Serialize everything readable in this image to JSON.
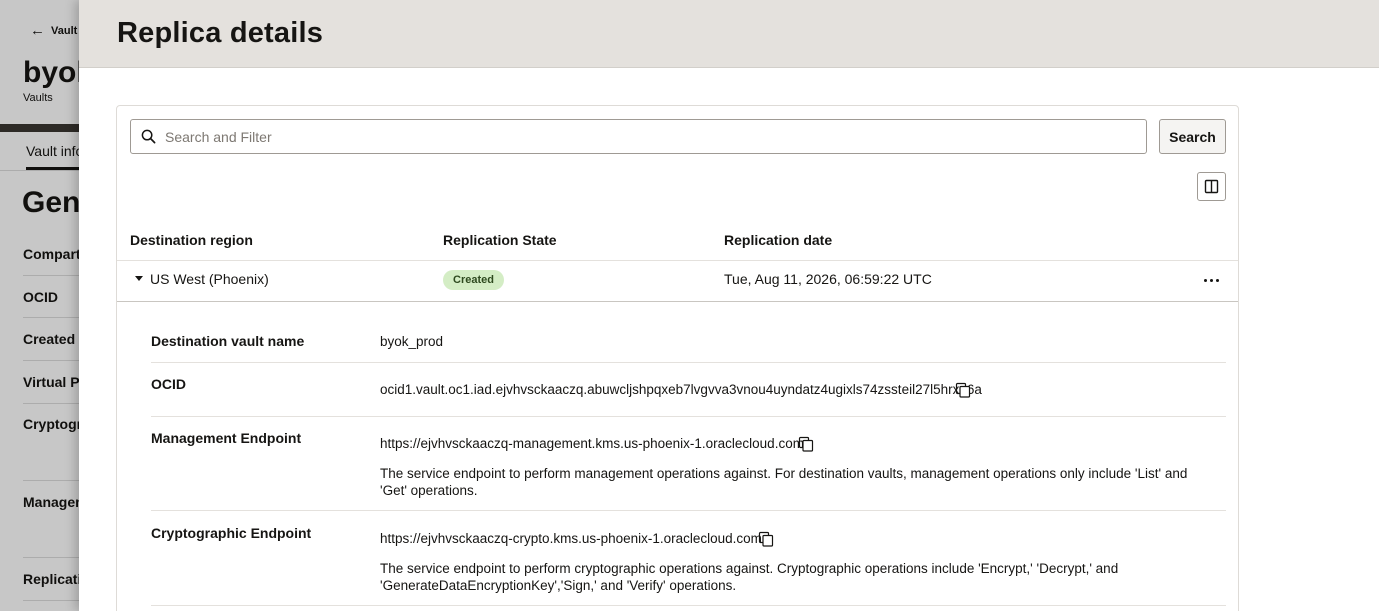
{
  "background_page": {
    "back_link": "Vault",
    "title": "byok",
    "subtitle": "Vaults",
    "tab": "Vault info",
    "section_title": "Gene",
    "labels": [
      "Compartm",
      "OCID",
      "Created",
      "Virtual Pr",
      "Cryptograp",
      "Managem",
      "Replicatio"
    ]
  },
  "panel": {
    "title": "Replica details",
    "search": {
      "placeholder": "Search and Filter",
      "button": "Search"
    },
    "table": {
      "headers": [
        "Destination region",
        "Replication State",
        "Replication date"
      ],
      "row": {
        "region": "US West (Phoenix)",
        "state": "Created",
        "date": "Tue, Aug 11, 2026, 06:59:22 UTC"
      }
    },
    "details": {
      "vault_name_label": "Destination vault name",
      "vault_name": "byok_prod",
      "ocid_label": "OCID",
      "ocid": "ocid1.vault.oc1.iad.ejvhvsckaaczq.abuwcljshpqxeb7lvgvva3vnou4uyndatz4ugixls74zssteil27l5hrxp6a",
      "mgmt_label": "Management Endpoint",
      "mgmt_url": "https://ejvhvsckaaczq-management.kms.us-phoenix-1.oraclecloud.com",
      "mgmt_desc": "The service endpoint to perform management operations against. For destination vaults, management operations only include 'List' and 'Get' operations.",
      "crypto_label": "Cryptographic Endpoint",
      "crypto_url": "https://ejvhvsckaaczq-crypto.kms.us-phoenix-1.oraclecloud.com",
      "crypto_desc": "The service endpoint to perform cryptographic operations against. Cryptographic operations include 'Encrypt,' 'Decrypt,' and 'GenerateDataEncryptionKey','Sign,' and 'Verify' operations."
    }
  },
  "colors": {
    "badge_bg": "#d4edc5",
    "header_bg": "#e4e1dd"
  },
  "icons": [
    "arrow-left-icon",
    "search-icon",
    "columns-icon",
    "kebab-menu-icon",
    "copy-icon",
    "caret-down-icon"
  ]
}
